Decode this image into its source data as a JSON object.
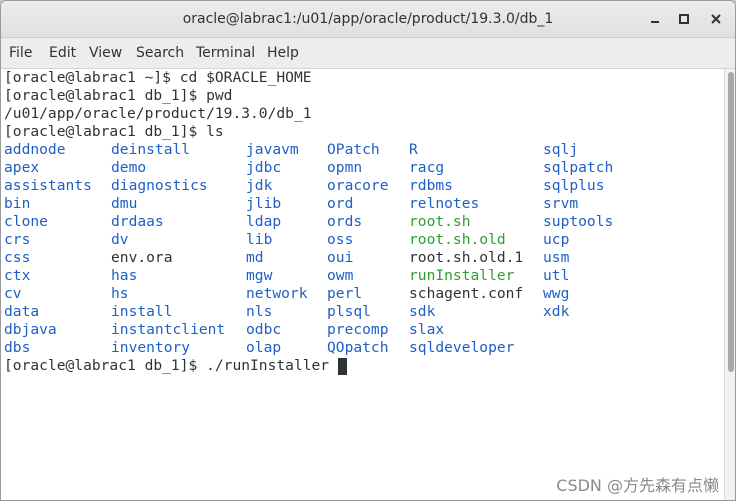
{
  "window": {
    "title": "oracle@labrac1:/u01/app/oracle/product/19.3.0/db_1"
  },
  "menu": [
    "File",
    "Edit",
    "View",
    "Search",
    "Terminal",
    "Help"
  ],
  "icons": {
    "minimize": "minimize-icon",
    "maximize": "maximize-icon",
    "close": "close-icon"
  },
  "colors": {
    "directory": "#1f5fc8",
    "executable": "#2f9e2f",
    "text": "#2e3436"
  },
  "terminal": {
    "lines_before": [
      "[oracle@labrac1 ~]$ cd $ORACLE_HOME",
      "[oracle@labrac1 db_1]$ pwd",
      "/u01/app/oracle/product/19.3.0/db_1",
      "[oracle@labrac1 db_1]$ ls"
    ],
    "ls_columns": [
      [
        {
          "name": "addnode",
          "kind": "dir"
        },
        {
          "name": "apex",
          "kind": "dir"
        },
        {
          "name": "assistants",
          "kind": "dir"
        },
        {
          "name": "bin",
          "kind": "dir"
        },
        {
          "name": "clone",
          "kind": "dir"
        },
        {
          "name": "crs",
          "kind": "dir"
        },
        {
          "name": "css",
          "kind": "dir"
        },
        {
          "name": "ctx",
          "kind": "dir"
        },
        {
          "name": "cv",
          "kind": "dir"
        },
        {
          "name": "data",
          "kind": "dir"
        },
        {
          "name": "dbjava",
          "kind": "dir"
        },
        {
          "name": "dbs",
          "kind": "dir"
        }
      ],
      [
        {
          "name": "deinstall",
          "kind": "dir"
        },
        {
          "name": "demo",
          "kind": "dir"
        },
        {
          "name": "diagnostics",
          "kind": "dir"
        },
        {
          "name": "dmu",
          "kind": "dir"
        },
        {
          "name": "drdaas",
          "kind": "dir"
        },
        {
          "name": "dv",
          "kind": "dir"
        },
        {
          "name": "env.ora",
          "kind": "plain"
        },
        {
          "name": "has",
          "kind": "dir"
        },
        {
          "name": "hs",
          "kind": "dir"
        },
        {
          "name": "install",
          "kind": "dir"
        },
        {
          "name": "instantclient",
          "kind": "dir"
        },
        {
          "name": "inventory",
          "kind": "dir"
        }
      ],
      [
        {
          "name": "javavm",
          "kind": "dir"
        },
        {
          "name": "jdbc",
          "kind": "dir"
        },
        {
          "name": "jdk",
          "kind": "dir"
        },
        {
          "name": "jlib",
          "kind": "dir"
        },
        {
          "name": "ldap",
          "kind": "dir"
        },
        {
          "name": "lib",
          "kind": "dir"
        },
        {
          "name": "md",
          "kind": "dir"
        },
        {
          "name": "mgw",
          "kind": "dir"
        },
        {
          "name": "network",
          "kind": "dir"
        },
        {
          "name": "nls",
          "kind": "dir"
        },
        {
          "name": "odbc",
          "kind": "dir"
        },
        {
          "name": "olap",
          "kind": "dir"
        }
      ],
      [
        {
          "name": "OPatch",
          "kind": "dir"
        },
        {
          "name": "opmn",
          "kind": "dir"
        },
        {
          "name": "oracore",
          "kind": "dir"
        },
        {
          "name": "ord",
          "kind": "dir"
        },
        {
          "name": "ords",
          "kind": "dir"
        },
        {
          "name": "oss",
          "kind": "dir"
        },
        {
          "name": "oui",
          "kind": "dir"
        },
        {
          "name": "owm",
          "kind": "dir"
        },
        {
          "name": "perl",
          "kind": "dir"
        },
        {
          "name": "plsql",
          "kind": "dir"
        },
        {
          "name": "precomp",
          "kind": "dir"
        },
        {
          "name": "QOpatch",
          "kind": "dir"
        }
      ],
      [
        {
          "name": "R",
          "kind": "dir"
        },
        {
          "name": "racg",
          "kind": "dir"
        },
        {
          "name": "rdbms",
          "kind": "dir"
        },
        {
          "name": "relnotes",
          "kind": "dir"
        },
        {
          "name": "root.sh",
          "kind": "exe"
        },
        {
          "name": "root.sh.old",
          "kind": "exe"
        },
        {
          "name": "root.sh.old.1",
          "kind": "plain"
        },
        {
          "name": "runInstaller",
          "kind": "exe"
        },
        {
          "name": "schagent.conf",
          "kind": "plain"
        },
        {
          "name": "sdk",
          "kind": "dir"
        },
        {
          "name": "slax",
          "kind": "dir"
        },
        {
          "name": "sqldeveloper",
          "kind": "dir"
        }
      ],
      [
        {
          "name": "sqlj",
          "kind": "dir"
        },
        {
          "name": "sqlpatch",
          "kind": "dir"
        },
        {
          "name": "sqlplus",
          "kind": "dir"
        },
        {
          "name": "srvm",
          "kind": "dir"
        },
        {
          "name": "suptools",
          "kind": "dir"
        },
        {
          "name": "ucp",
          "kind": "dir"
        },
        {
          "name": "usm",
          "kind": "dir"
        },
        {
          "name": "utl",
          "kind": "dir"
        },
        {
          "name": "wwg",
          "kind": "dir"
        },
        {
          "name": "xdk",
          "kind": "dir"
        }
      ]
    ],
    "last_line": "[oracle@labrac1 db_1]$ ./runInstaller"
  },
  "watermark": "CSDN @方先森有点懒"
}
